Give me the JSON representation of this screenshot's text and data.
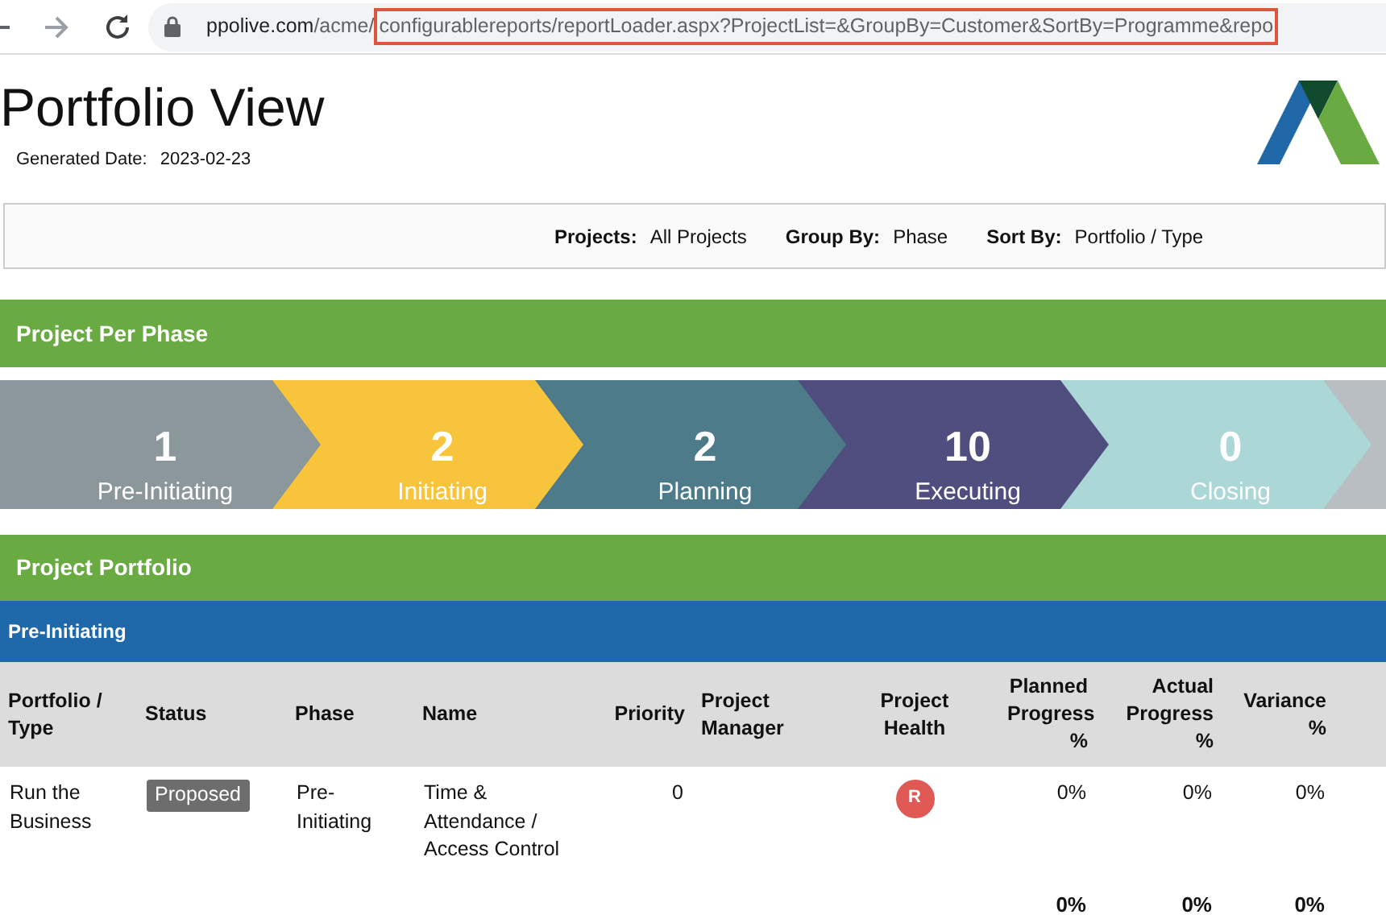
{
  "browser": {
    "url_host": "ppolive.com",
    "url_dir": "/acme/",
    "url_highlighted": "configurablereports/reportLoader.aspx?ProjectList=&GroupBy=Customer&SortBy=Programme&repo"
  },
  "header": {
    "title": "Portfolio View",
    "generated_label": "Generated Date:",
    "generated_value": "2023-02-23"
  },
  "filters": [
    {
      "label": "Projects:",
      "value": "All Projects"
    },
    {
      "label": "Group By:",
      "value": "Phase"
    },
    {
      "label": "Sort By:",
      "value": "Portfolio / Type"
    }
  ],
  "phase_section": {
    "title": "Project Per Phase"
  },
  "phases": [
    {
      "count": "1",
      "label": "Pre-Initiating",
      "color": "#8c979b"
    },
    {
      "count": "2",
      "label": "Initiating",
      "color": "#f7c43c"
    },
    {
      "count": "2",
      "label": "Planning",
      "color": "#4d7b8a"
    },
    {
      "count": "10",
      "label": "Executing",
      "color": "#4f4e7e"
    },
    {
      "count": "0",
      "label": "Closing",
      "color": "#abd8d7"
    },
    {
      "color": "#b8bec2"
    }
  ],
  "portfolio_section": {
    "title": "Project Portfolio"
  },
  "group": {
    "title": "Pre-Initiating"
  },
  "table": {
    "columns": [
      {
        "label": "Portfolio / Type",
        "kind": "text"
      },
      {
        "label": "Status",
        "kind": "text"
      },
      {
        "label": "Phase",
        "kind": "text"
      },
      {
        "label": "Name",
        "kind": "text"
      },
      {
        "label": "Priority",
        "kind": "number"
      },
      {
        "label": "Project Manager",
        "kind": "text"
      },
      {
        "label": "Project Health",
        "kind": "indicator"
      },
      {
        "label": "Planned Progress",
        "unit": "%",
        "kind": "number"
      },
      {
        "label": "Actual Progress",
        "unit": "%",
        "kind": "number"
      },
      {
        "label": "Variance",
        "unit": "%",
        "kind": "number"
      }
    ],
    "rows": [
      {
        "portfolio": "Run the Business",
        "status": "Proposed",
        "phase": "Pre-Initiating",
        "name": "Time & Attendance / Access Control",
        "priority": "0",
        "health": {
          "label": "R",
          "color": "#e05a55"
        },
        "planned": "0%",
        "actual": "0%",
        "variance": "0%"
      }
    ],
    "totals": {
      "planned": "0%",
      "actual": "0%",
      "variance": "0%"
    }
  }
}
